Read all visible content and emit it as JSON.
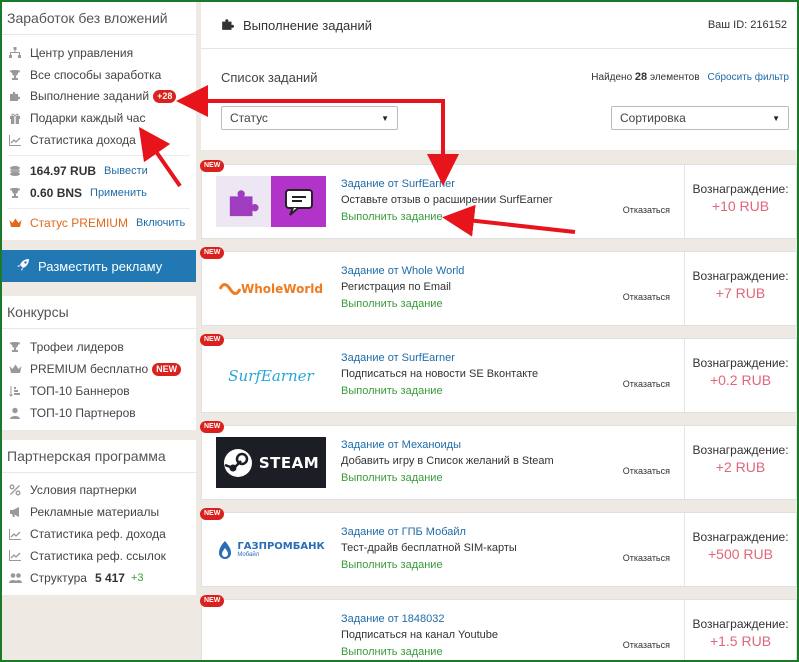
{
  "sidebar": {
    "earn_title": "Заработок без вложений",
    "nav": [
      {
        "label": "Центр управления",
        "icon": "hierarchy-icon"
      },
      {
        "label": "Все способы заработка",
        "icon": "trophy-icon"
      },
      {
        "label": "Выполнение заданий",
        "icon": "puzzle-icon",
        "badge": "+28"
      },
      {
        "label": "Подарки каждый час",
        "icon": "gift-icon"
      },
      {
        "label": "Статистика дохода",
        "icon": "chart-icon"
      }
    ],
    "balance_rub": "164.97 RUB",
    "withdraw": "Вывести",
    "balance_bns": "0.60 BNS",
    "apply": "Применить",
    "premium_status": "Статус PREMIUM",
    "enable": "Включить",
    "ad_button": "Разместить рекламу",
    "contests_title": "Конкурсы",
    "contests": [
      {
        "label": "Трофеи лидеров"
      },
      {
        "label": "PREMIUM бесплатно",
        "badge": "NEW"
      },
      {
        "label": "ТОП-10 Баннеров"
      },
      {
        "label": "ТОП-10 Партнеров"
      }
    ],
    "partner_title": "Партнерская программа",
    "partner": [
      {
        "label": "Условия партнерки"
      },
      {
        "label": "Рекламные материалы"
      },
      {
        "label": "Статистика реф. дохода"
      },
      {
        "label": "Статистика реф. ссылок"
      }
    ],
    "structure_label": "Структура",
    "structure_value": "5 417",
    "structure_delta": "+3"
  },
  "header": {
    "title": "Выполнение заданий",
    "user_id": "Ваш ID: 216152"
  },
  "tools": {
    "list_title": "Список заданий",
    "found_prefix": "Найдено",
    "found_count": "28",
    "found_suffix": "элементов",
    "reset": "Сбросить фильтр",
    "status_select": "Статус",
    "sort_select": "Сортировка"
  },
  "tasks": [
    {
      "badge": "NEW",
      "name": "Задание от SurfEarner",
      "desc": "Оставьте отзыв о расширении SurfEarner",
      "action": "Выполнить задание",
      "cancel": "Отказаться",
      "reward_label": "Вознаграждение:",
      "reward": "+10 RUB",
      "logo": "surfearner-extension"
    },
    {
      "badge": "NEW",
      "name": "Задание от Whole World",
      "desc": "Регистрация по Email",
      "action": "Выполнить задание",
      "cancel": "Отказаться",
      "reward_label": "Вознаграждение:",
      "reward": "+7 RUB",
      "logo": "wholeworld",
      "logo_text": "WholeWorld"
    },
    {
      "badge": "NEW",
      "name": "Задание от SurfEarner",
      "desc": "Подписаться на новости SE Вконтакте",
      "action": "Выполнить задание",
      "cancel": "Отказаться",
      "reward_label": "Вознаграждение:",
      "reward": "+0.2 RUB",
      "logo": "surfearner",
      "logo_text": "SurfEarner"
    },
    {
      "badge": "NEW",
      "name": "Задание от Механоиды",
      "desc": "Добавить игру в Список желаний в Steam",
      "action": "Выполнить задание",
      "cancel": "Отказаться",
      "reward_label": "Вознаграждение:",
      "reward": "+2 RUB",
      "logo": "steam",
      "logo_text": "STEAM"
    },
    {
      "badge": "NEW",
      "name": "Задание от ГПБ Мобайл",
      "desc": "Тест-драйв бесплатной SIM-карты",
      "action": "Выполнить задание",
      "cancel": "Отказаться",
      "reward_label": "Вознаграждение:",
      "reward": "+500 RUB",
      "logo": "gazprombank",
      "logo_text": "ГАЗПРОМБАНК",
      "logo_subtext": "Мобайл"
    },
    {
      "badge": "NEW",
      "name": "Задание от 1848032",
      "desc": "Подписаться на канал Youtube",
      "action": "Выполнить задание",
      "cancel": "Отказаться",
      "reward_label": "Вознаграждение:",
      "reward": "+1.5 RUB",
      "logo": "blank"
    }
  ],
  "colors": {
    "link": "#1f6ca8",
    "action": "#3a9b3a",
    "reward": "#e0667a",
    "badge": "#d9211e",
    "ad_button": "#2178b3",
    "annotation_arrow": "#e8141b"
  }
}
